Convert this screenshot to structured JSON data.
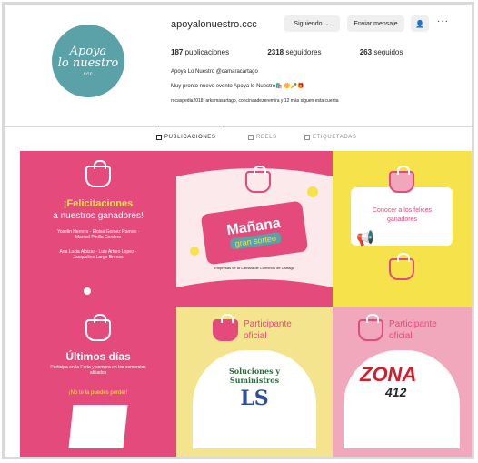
{
  "profile": {
    "username": "apoyalonuestro.ccc",
    "avatar_line1": "Apoya",
    "avatar_line2": "lo nuestro",
    "avatar_sub": "ccc",
    "following_label": "Siguiendo",
    "message_label": "Enviar mensaje",
    "more_label": "···",
    "posts_count": "187",
    "posts_label": "publicaciones",
    "followers_count": "2318",
    "followers_label": "seguidores",
    "following_count": "263",
    "following_count_label": "seguidos",
    "full_name": "Apoya Lo Nuestro @camaracartago",
    "bio": "Muy pronto nuevo evento Apoya lo Nuestro🛍️ 🌼🥕🎁",
    "followed_by": "rocaspedia2018, arkamasartago, concinaadezeremira y 12 más siguen esta cuenta"
  },
  "tabs": {
    "posts": "PUBLICACIONES",
    "reels": "REELS",
    "tagged": "ETIQUETADAS"
  },
  "posts": {
    "p1": {
      "title": "¡Felicitaciones",
      "subtitle": "a nuestros ganadores!",
      "names": "Yoselin Herrera · Eloisa Gomez Ramos · Marisol Pinilla Cordero",
      "names2": "Ana Lucia Alpizar · Luis Arturo Lopez · Jacqueline Largo Brenes"
    },
    "p2": {
      "line1": "Mañana",
      "line2": "gran sorteo",
      "note": "Empresas de la Cámara de Comercio de Cartago"
    },
    "p3": {
      "line1": "Conocer a los felices",
      "line2": "ganadores"
    },
    "p4": {
      "title": "Últimos días",
      "body": "Participa en la Feria y compra en los comercios afiliados",
      "cta": "¡No te la puedes perder!"
    },
    "p5": {
      "line1": "Participante",
      "line2": "oficial",
      "brand1": "Soluciones y",
      "brand2": "Suministros",
      "brand3": "LS"
    },
    "p6": {
      "line1": "Participante",
      "line2": "oficial",
      "brand1": "ZONA",
      "brand2": "412"
    }
  }
}
